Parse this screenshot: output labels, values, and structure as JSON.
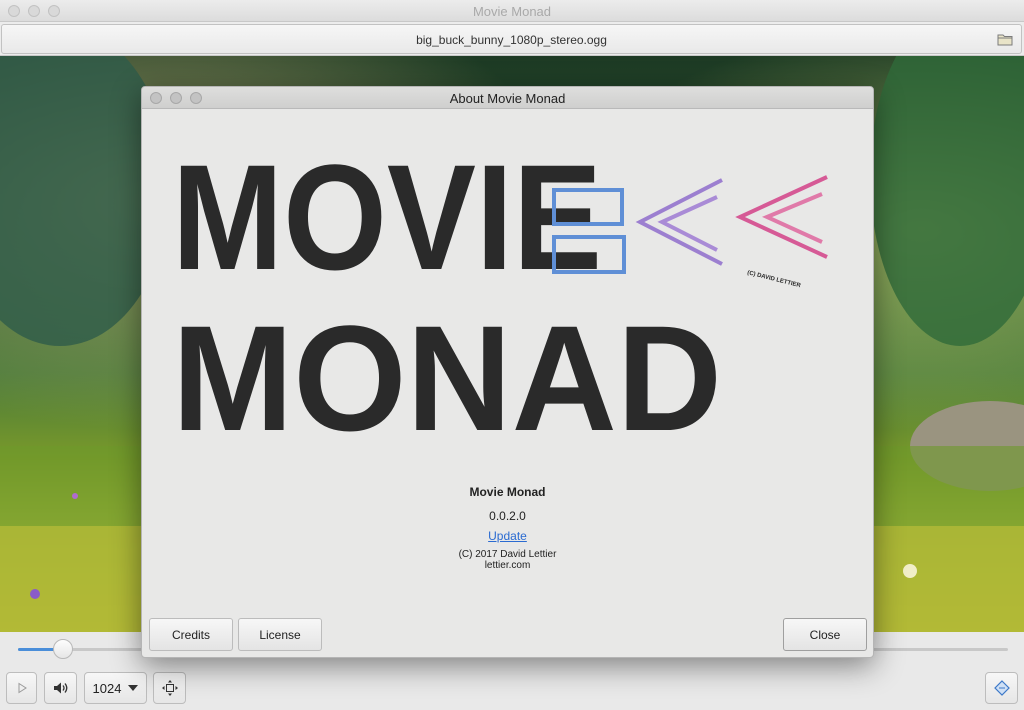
{
  "window": {
    "title": "Movie Monad"
  },
  "file_chooser": {
    "filename": "big_buck_bunny_1080p_stereo.ogg",
    "icon": "folder-icon"
  },
  "controls": {
    "seek_progress_fraction": 0.045,
    "size_label": "1024",
    "play_icon": "play-icon",
    "volume_icon": "volume-icon",
    "fullscreen_icon": "fullscreen-icon",
    "info_icon": "info-icon"
  },
  "about": {
    "title": "About Movie Monad",
    "logo_line1": "MOVIE",
    "logo_line2": "MONAD",
    "logo_credit": "(C) DAVID LETTIER",
    "app_name": "Movie Monad",
    "version": "0.0.2.0",
    "update_link": "Update",
    "copyright": "(C) 2017 David Lettier",
    "website": "lettier.com",
    "credits_button": "Credits",
    "license_button": "License",
    "close_button": "Close"
  },
  "colors": {
    "accent": "#4a8ed9",
    "link": "#2b6bd1",
    "logo_blue": "#5f8fd6",
    "logo_purple": "#9c7fd0",
    "logo_pink": "#d65a96"
  }
}
